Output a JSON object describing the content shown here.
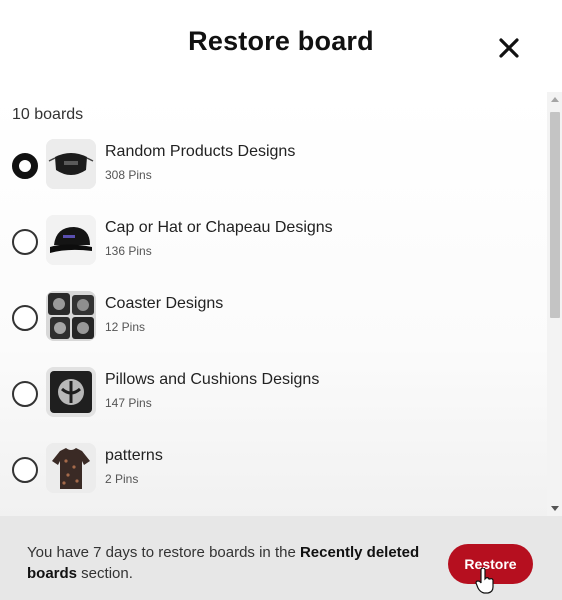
{
  "modal": {
    "title": "Restore board",
    "close_icon": "close-icon"
  },
  "list": {
    "count_label": "10 boards",
    "boards": [
      {
        "name": "Random Products Designs",
        "pins": "308 Pins",
        "selected": true,
        "thumb": "face-mask"
      },
      {
        "name": "Cap or Hat or Chapeau Designs",
        "pins": "136 Pins",
        "selected": false,
        "thumb": "cap"
      },
      {
        "name": "Coaster Designs",
        "pins": "12 Pins",
        "selected": false,
        "thumb": "coasters"
      },
      {
        "name": "Pillows and Cushions Designs",
        "pins": "147 Pins",
        "selected": false,
        "thumb": "pillow"
      },
      {
        "name": "patterns",
        "pins": "2 Pins",
        "selected": false,
        "thumb": "tshirt"
      }
    ]
  },
  "footer": {
    "text_prefix": "You have 7 days to restore boards in the ",
    "text_bold": "Recently deleted boards",
    "text_suffix": " section.",
    "restore_label": "Restore"
  },
  "colors": {
    "accent": "#b60f1f",
    "footer_bg": "#e7e7e7"
  }
}
